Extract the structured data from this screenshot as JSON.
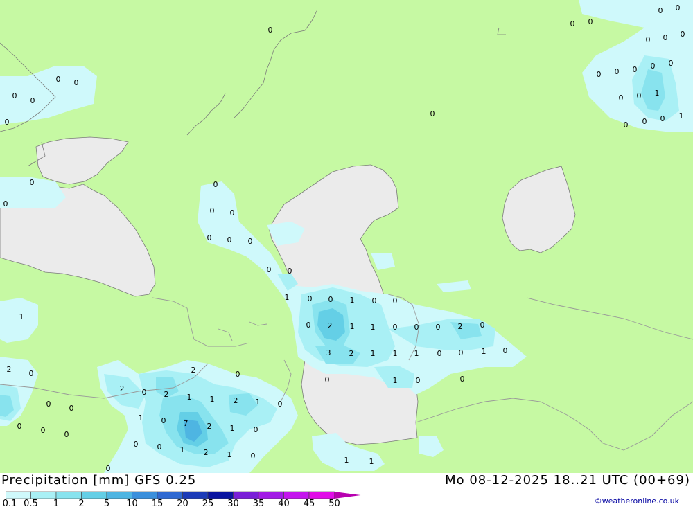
{
  "title": "Precipitation [mm]  GFS 0.25",
  "timestamp": "Mo 08-12-2025 18..21 UTC (00+69)",
  "credit": "©weatheronline.co.uk",
  "colors": {
    "land": "#c6f9a3",
    "water": "#ebebeb",
    "border": "#999999",
    "levels": [
      "#cff9fb",
      "#a9f0f5",
      "#88e3ee",
      "#64cfe6",
      "#4eb5e2",
      "#3a8fdc",
      "#2f69d2",
      "#1c3bb8",
      "#0a14a0",
      "#7a1fd8",
      "#a21ae6",
      "#c414ee",
      "#e10ce8",
      "#b800b0"
    ]
  },
  "legend": {
    "labels": [
      "0.1",
      "0.5",
      "1",
      "2",
      "5",
      "10",
      "15",
      "20",
      "25",
      "30",
      "35",
      "40",
      "45",
      "50"
    ]
  },
  "values": [
    {
      "text": "0"
    },
    {
      "text": "0"
    },
    {
      "text": "0"
    },
    {
      "text": "0"
    },
    {
      "text": "0"
    },
    {
      "text": "0"
    },
    {
      "text": "0"
    },
    {
      "text": "0"
    },
    {
      "text": "0"
    },
    {
      "text": "0"
    },
    {
      "text": "0"
    },
    {
      "text": "0"
    },
    {
      "text": "0"
    },
    {
      "text": "1"
    },
    {
      "text": "0"
    },
    {
      "text": "0"
    },
    {
      "text": "0"
    },
    {
      "text": "0"
    },
    {
      "text": "1"
    },
    {
      "text": "0"
    },
    {
      "text": "0"
    },
    {
      "text": "0"
    },
    {
      "text": "0"
    },
    {
      "text": "0"
    },
    {
      "text": "0"
    },
    {
      "text": "0"
    },
    {
      "text": "0"
    },
    {
      "text": "0"
    },
    {
      "text": "0"
    },
    {
      "text": "0"
    },
    {
      "text": "0"
    },
    {
      "text": "0"
    },
    {
      "text": "0"
    },
    {
      "text": "0"
    },
    {
      "text": "0"
    },
    {
      "text": "0"
    },
    {
      "text": "0"
    },
    {
      "text": "1"
    },
    {
      "text": "0"
    },
    {
      "text": "1"
    },
    {
      "text": "1"
    },
    {
      "text": "0"
    },
    {
      "text": "0"
    },
    {
      "text": "0"
    },
    {
      "text": "2"
    },
    {
      "text": "1"
    },
    {
      "text": "1"
    },
    {
      "text": "0"
    },
    {
      "text": "0"
    },
    {
      "text": "0"
    },
    {
      "text": "2"
    },
    {
      "text": "0"
    },
    {
      "text": "3"
    },
    {
      "text": "2"
    },
    {
      "text": "1"
    },
    {
      "text": "1"
    },
    {
      "text": "1"
    },
    {
      "text": "0"
    },
    {
      "text": "0"
    },
    {
      "text": "1"
    },
    {
      "text": "0"
    },
    {
      "text": "0"
    },
    {
      "text": "1"
    },
    {
      "text": "0"
    },
    {
      "text": "0"
    },
    {
      "text": "2"
    },
    {
      "text": "0"
    },
    {
      "text": "2"
    },
    {
      "text": "0"
    },
    {
      "text": "2"
    },
    {
      "text": "2"
    },
    {
      "text": "0"
    },
    {
      "text": "1"
    },
    {
      "text": "1"
    },
    {
      "text": "2"
    },
    {
      "text": "1"
    },
    {
      "text": "0"
    },
    {
      "text": "0"
    },
    {
      "text": "0"
    },
    {
      "text": "1"
    },
    {
      "text": "0"
    },
    {
      "text": "7"
    },
    {
      "text": "2"
    },
    {
      "text": "1"
    },
    {
      "text": "0"
    },
    {
      "text": "0"
    },
    {
      "text": "0"
    },
    {
      "text": "0"
    },
    {
      "text": "0"
    },
    {
      "text": "1"
    },
    {
      "text": "2"
    },
    {
      "text": "1"
    },
    {
      "text": "0"
    },
    {
      "text": "0"
    },
    {
      "text": "0"
    },
    {
      "text": "1"
    },
    {
      "text": "1"
    }
  ]
}
